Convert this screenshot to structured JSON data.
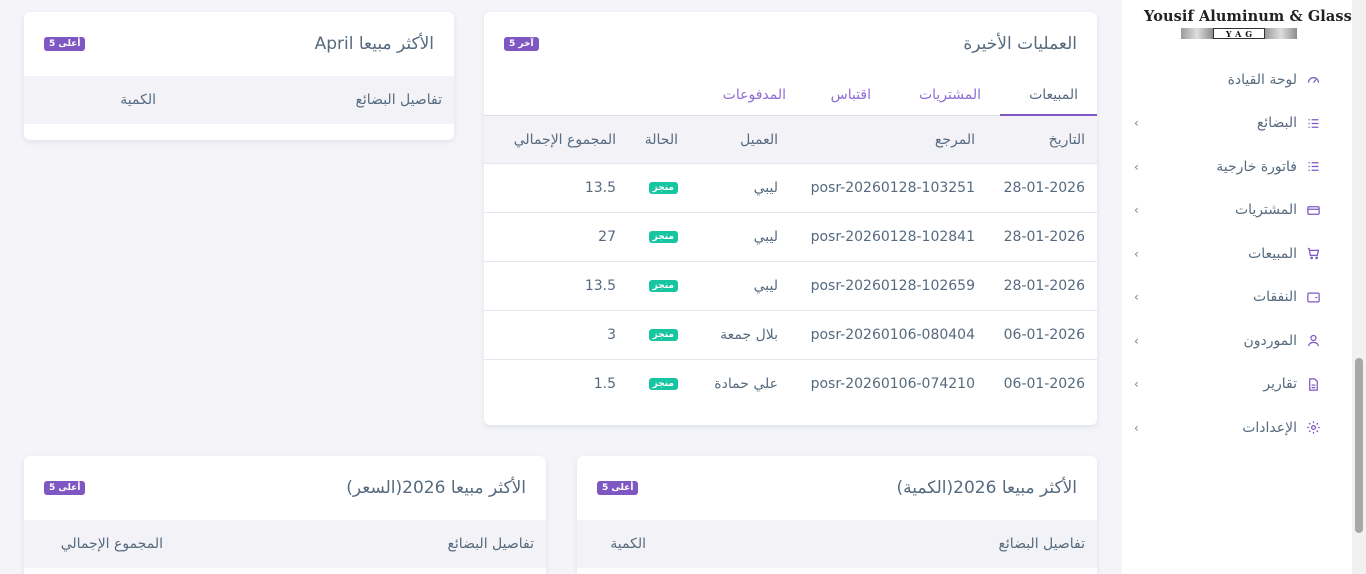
{
  "sidebar": {
    "logo_text": "Yousif Aluminum & Glass",
    "logo_sub": "YAG",
    "items": [
      {
        "label": "لوحة القيادة",
        "icon": "gauge-icon"
      },
      {
        "label": "البضائع",
        "icon": "list-icon"
      },
      {
        "label": "فاتورة خارجية",
        "icon": "list-icon"
      },
      {
        "label": "المشتريات",
        "icon": "card-icon"
      },
      {
        "label": "المبيعات",
        "icon": "cart-icon"
      },
      {
        "label": "النفقات",
        "icon": "wallet-icon"
      },
      {
        "label": "الموردون",
        "icon": "user-icon"
      },
      {
        "label": "تقارير",
        "icon": "file-icon"
      },
      {
        "label": "الإعدادات",
        "icon": "gear-icon"
      }
    ]
  },
  "recent": {
    "title": "العمليات الأخيرة",
    "badge": "آخر 5",
    "tabs": [
      "المبيعات",
      "المشتريات",
      "اقتباس",
      "المدفوعات"
    ],
    "columns": {
      "date": "التاريخ",
      "ref": "المرجع",
      "client": "العميل",
      "status": "الحالة",
      "total": "المجموع الإجمالي"
    },
    "rows": [
      {
        "date": "28-01-2026",
        "ref": "posr-20260128-103251",
        "client": "ليبي",
        "status": "منجز",
        "total": "13.5"
      },
      {
        "date": "28-01-2026",
        "ref": "posr-20260128-102841",
        "client": "ليبي",
        "status": "منجز",
        "total": "27"
      },
      {
        "date": "28-01-2026",
        "ref": "posr-20260128-102659",
        "client": "ليبي",
        "status": "منجز",
        "total": "13.5"
      },
      {
        "date": "06-01-2026",
        "ref": "posr-20260106-080404",
        "client": "بلال جمعة",
        "status": "منجز",
        "total": "3"
      },
      {
        "date": "06-01-2026",
        "ref": "posr-20260106-074210",
        "client": "علي حمادة",
        "status": "منجز",
        "total": "1.5"
      }
    ]
  },
  "top_april": {
    "title": "الأكثر مبيعا April",
    "badge": "أعلى 5",
    "col_details": "تفاصيل البضائع",
    "col_qty": "الكمية"
  },
  "top_qty": {
    "title": "الأكثر مبيعا 2026(الكمية)",
    "badge": "أعلى 5",
    "col_details": "تفاصيل البضائع",
    "col_qty": "الكمية"
  },
  "top_price": {
    "title": "الأكثر مبيعا 2026(السعر)",
    "badge": "أعلى 5",
    "col_details": "تفاصيل البضائع",
    "col_total": "المجموع الإجمالي"
  },
  "colors": {
    "accent": "#7e57c2",
    "success": "#17c6a0",
    "text": "#566a7f"
  }
}
